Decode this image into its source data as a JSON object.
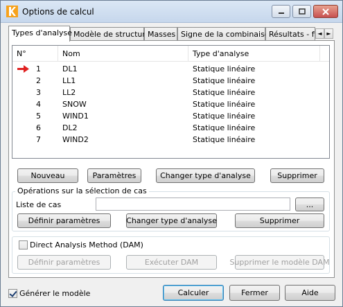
{
  "window": {
    "title": "Options de calcul"
  },
  "tabs": [
    "Types d'analyse",
    "Modèle de structure",
    "Masses",
    "Signe de la combinaison",
    "Résultats - fil"
  ],
  "tab_scroll": {
    "left": "◄",
    "right": "►"
  },
  "list": {
    "columns": [
      "N°",
      "Nom",
      "Type d'analyse"
    ],
    "rows": [
      {
        "num": "1",
        "name": "DL1",
        "type": "Statique linéaire"
      },
      {
        "num": "2",
        "name": "LL1",
        "type": "Statique linéaire"
      },
      {
        "num": "3",
        "name": "LL2",
        "type": "Statique linéaire"
      },
      {
        "num": "4",
        "name": "SNOW",
        "type": "Statique linéaire"
      },
      {
        "num": "5",
        "name": "WIND1",
        "type": "Statique linéaire"
      },
      {
        "num": "6",
        "name": "DL2",
        "type": "Statique linéaire"
      },
      {
        "num": "7",
        "name": "WIND2",
        "type": "Statique linéaire"
      }
    ]
  },
  "actions": {
    "new": "Nouveau",
    "params": "Paramètres",
    "change_type": "Changer type d'analyse",
    "delete": "Supprimer"
  },
  "selection_ops": {
    "title": "Opérations sur la sélection de cas",
    "case_list_label": "Liste de cas",
    "case_list_value": "",
    "browse": "...",
    "define_params": "Définir paramètres",
    "change_type": "Changer type d'analyse",
    "delete": "Supprimer"
  },
  "dam": {
    "checkbox_label": "Direct Analysis Method (DAM)",
    "checked": false,
    "define_params": "Définir paramètres",
    "run": "Exécuter DAM",
    "delete_model": "Supprimer le modèle DAM"
  },
  "footer": {
    "generate_model": "Générer le modèle",
    "generate_checked": true,
    "compute": "Calculer",
    "close": "Fermer",
    "help": "Aide"
  },
  "colors": {
    "arrow": "#e02020",
    "title_bg": "#c6d7ec"
  }
}
